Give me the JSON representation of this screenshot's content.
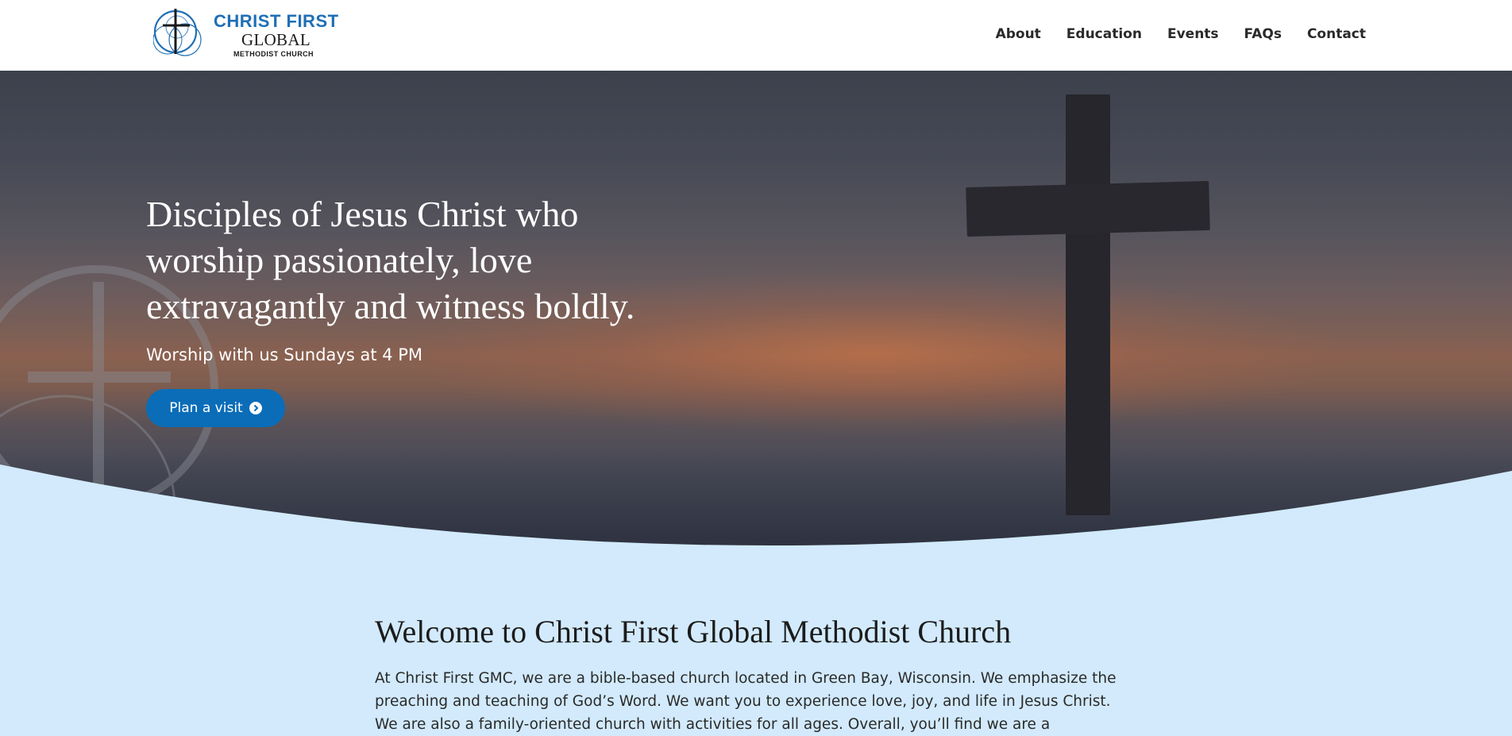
{
  "header": {
    "logo": {
      "line1": "CHRIST FIRST",
      "line2": "GLOBAL",
      "line3": "METHODIST CHURCH",
      "icon": "cross-circles-icon",
      "brand_color": "#1f6fb5"
    },
    "nav": [
      "About",
      "Education",
      "Events",
      "FAQs",
      "Contact"
    ]
  },
  "hero": {
    "title": "Disciples of Jesus Christ who worship passionately, love extravagantly and witness boldly.",
    "subtitle": "Worship with us Sundays at 4 PM",
    "button_label": "Plan a visit",
    "button_icon": "chevron-circle-right-icon",
    "accent": "#0b6db8",
    "background_image": "sunset-cross-silhouette"
  },
  "welcome": {
    "title": "Welcome to Christ First Global Methodist Church",
    "text": "At Christ First GMC, we are a bible-based church located in Green Bay, Wisconsin. We emphasize the preaching and teaching of God’s Word. We want you to experience love, joy, and life in Jesus Christ. We are also a family-oriented church with activities for all ages.  Overall, you’ll find we are a",
    "background": "#d2eafc"
  }
}
